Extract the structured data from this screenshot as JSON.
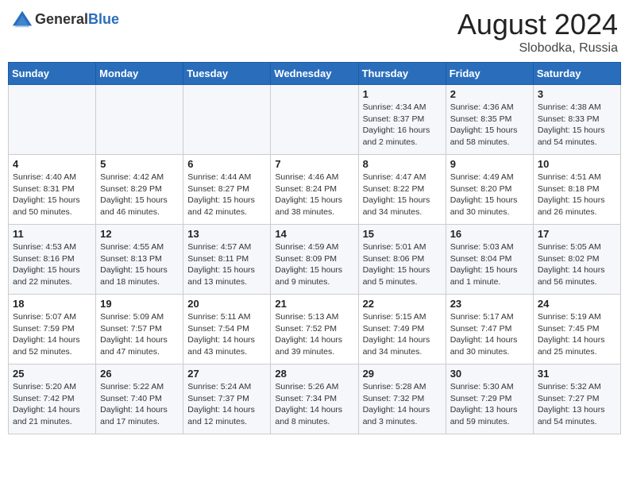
{
  "header": {
    "logo_general": "General",
    "logo_blue": "Blue",
    "month_year": "August 2024",
    "location": "Slobodka, Russia"
  },
  "weekdays": [
    "Sunday",
    "Monday",
    "Tuesday",
    "Wednesday",
    "Thursday",
    "Friday",
    "Saturday"
  ],
  "weeks": [
    [
      {
        "day": "",
        "info": ""
      },
      {
        "day": "",
        "info": ""
      },
      {
        "day": "",
        "info": ""
      },
      {
        "day": "",
        "info": ""
      },
      {
        "day": "1",
        "info": "Sunrise: 4:34 AM\nSunset: 8:37 PM\nDaylight: 16 hours\nand 2 minutes."
      },
      {
        "day": "2",
        "info": "Sunrise: 4:36 AM\nSunset: 8:35 PM\nDaylight: 15 hours\nand 58 minutes."
      },
      {
        "day": "3",
        "info": "Sunrise: 4:38 AM\nSunset: 8:33 PM\nDaylight: 15 hours\nand 54 minutes."
      }
    ],
    [
      {
        "day": "4",
        "info": "Sunrise: 4:40 AM\nSunset: 8:31 PM\nDaylight: 15 hours\nand 50 minutes."
      },
      {
        "day": "5",
        "info": "Sunrise: 4:42 AM\nSunset: 8:29 PM\nDaylight: 15 hours\nand 46 minutes."
      },
      {
        "day": "6",
        "info": "Sunrise: 4:44 AM\nSunset: 8:27 PM\nDaylight: 15 hours\nand 42 minutes."
      },
      {
        "day": "7",
        "info": "Sunrise: 4:46 AM\nSunset: 8:24 PM\nDaylight: 15 hours\nand 38 minutes."
      },
      {
        "day": "8",
        "info": "Sunrise: 4:47 AM\nSunset: 8:22 PM\nDaylight: 15 hours\nand 34 minutes."
      },
      {
        "day": "9",
        "info": "Sunrise: 4:49 AM\nSunset: 8:20 PM\nDaylight: 15 hours\nand 30 minutes."
      },
      {
        "day": "10",
        "info": "Sunrise: 4:51 AM\nSunset: 8:18 PM\nDaylight: 15 hours\nand 26 minutes."
      }
    ],
    [
      {
        "day": "11",
        "info": "Sunrise: 4:53 AM\nSunset: 8:16 PM\nDaylight: 15 hours\nand 22 minutes."
      },
      {
        "day": "12",
        "info": "Sunrise: 4:55 AM\nSunset: 8:13 PM\nDaylight: 15 hours\nand 18 minutes."
      },
      {
        "day": "13",
        "info": "Sunrise: 4:57 AM\nSunset: 8:11 PM\nDaylight: 15 hours\nand 13 minutes."
      },
      {
        "day": "14",
        "info": "Sunrise: 4:59 AM\nSunset: 8:09 PM\nDaylight: 15 hours\nand 9 minutes."
      },
      {
        "day": "15",
        "info": "Sunrise: 5:01 AM\nSunset: 8:06 PM\nDaylight: 15 hours\nand 5 minutes."
      },
      {
        "day": "16",
        "info": "Sunrise: 5:03 AM\nSunset: 8:04 PM\nDaylight: 15 hours\nand 1 minute."
      },
      {
        "day": "17",
        "info": "Sunrise: 5:05 AM\nSunset: 8:02 PM\nDaylight: 14 hours\nand 56 minutes."
      }
    ],
    [
      {
        "day": "18",
        "info": "Sunrise: 5:07 AM\nSunset: 7:59 PM\nDaylight: 14 hours\nand 52 minutes."
      },
      {
        "day": "19",
        "info": "Sunrise: 5:09 AM\nSunset: 7:57 PM\nDaylight: 14 hours\nand 47 minutes."
      },
      {
        "day": "20",
        "info": "Sunrise: 5:11 AM\nSunset: 7:54 PM\nDaylight: 14 hours\nand 43 minutes."
      },
      {
        "day": "21",
        "info": "Sunrise: 5:13 AM\nSunset: 7:52 PM\nDaylight: 14 hours\nand 39 minutes."
      },
      {
        "day": "22",
        "info": "Sunrise: 5:15 AM\nSunset: 7:49 PM\nDaylight: 14 hours\nand 34 minutes."
      },
      {
        "day": "23",
        "info": "Sunrise: 5:17 AM\nSunset: 7:47 PM\nDaylight: 14 hours\nand 30 minutes."
      },
      {
        "day": "24",
        "info": "Sunrise: 5:19 AM\nSunset: 7:45 PM\nDaylight: 14 hours\nand 25 minutes."
      }
    ],
    [
      {
        "day": "25",
        "info": "Sunrise: 5:20 AM\nSunset: 7:42 PM\nDaylight: 14 hours\nand 21 minutes."
      },
      {
        "day": "26",
        "info": "Sunrise: 5:22 AM\nSunset: 7:40 PM\nDaylight: 14 hours\nand 17 minutes."
      },
      {
        "day": "27",
        "info": "Sunrise: 5:24 AM\nSunset: 7:37 PM\nDaylight: 14 hours\nand 12 minutes."
      },
      {
        "day": "28",
        "info": "Sunrise: 5:26 AM\nSunset: 7:34 PM\nDaylight: 14 hours\nand 8 minutes."
      },
      {
        "day": "29",
        "info": "Sunrise: 5:28 AM\nSunset: 7:32 PM\nDaylight: 14 hours\nand 3 minutes."
      },
      {
        "day": "30",
        "info": "Sunrise: 5:30 AM\nSunset: 7:29 PM\nDaylight: 13 hours\nand 59 minutes."
      },
      {
        "day": "31",
        "info": "Sunrise: 5:32 AM\nSunset: 7:27 PM\nDaylight: 13 hours\nand 54 minutes."
      }
    ]
  ]
}
